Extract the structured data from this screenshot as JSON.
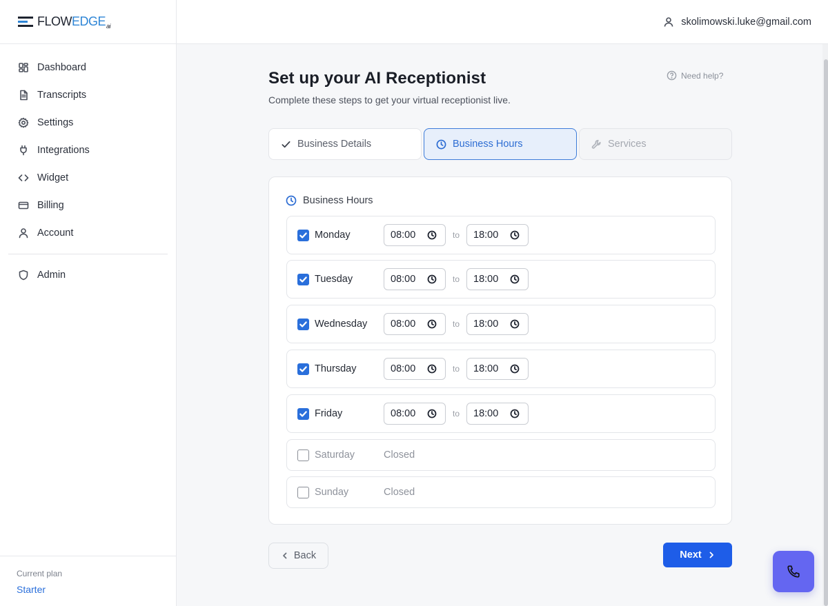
{
  "brand": {
    "part1": "FLOW",
    "part2": "EDGE",
    "part3": "ai"
  },
  "sidebar": {
    "items": [
      {
        "label": "Dashboard",
        "icon": "dashboard-icon"
      },
      {
        "label": "Transcripts",
        "icon": "document-icon"
      },
      {
        "label": "Settings",
        "icon": "gear-icon"
      },
      {
        "label": "Integrations",
        "icon": "plug-icon"
      },
      {
        "label": "Widget",
        "icon": "code-icon"
      },
      {
        "label": "Billing",
        "icon": "credit-card-icon"
      },
      {
        "label": "Account",
        "icon": "user-icon"
      }
    ],
    "admin": {
      "label": "Admin",
      "icon": "shield-icon"
    },
    "plan": {
      "label": "Current plan",
      "value": "Starter"
    }
  },
  "header": {
    "user_email": "skolimowski.luke@gmail.com"
  },
  "page": {
    "title": "Set up your AI Receptionist",
    "subtitle": "Complete these steps to get your virtual receptionist live.",
    "help_label": "Need help?"
  },
  "steps": [
    {
      "label": "Business Details",
      "state": "completed"
    },
    {
      "label": "Business Hours",
      "state": "active"
    },
    {
      "label": "Services",
      "state": "upcoming"
    }
  ],
  "hours": {
    "heading": "Business Hours",
    "to_label": "to",
    "closed_label": "Closed",
    "days": [
      {
        "name": "Monday",
        "enabled": true,
        "open": "08:00",
        "close": "18:00"
      },
      {
        "name": "Tuesday",
        "enabled": true,
        "open": "08:00",
        "close": "18:00"
      },
      {
        "name": "Wednesday",
        "enabled": true,
        "open": "08:00",
        "close": "18:00"
      },
      {
        "name": "Thursday",
        "enabled": true,
        "open": "08:00",
        "close": "18:00"
      },
      {
        "name": "Friday",
        "enabled": true,
        "open": "08:00",
        "close": "18:00"
      },
      {
        "name": "Saturday",
        "enabled": false
      },
      {
        "name": "Sunday",
        "enabled": false
      }
    ]
  },
  "actions": {
    "back_label": "Back",
    "next_label": "Next"
  },
  "colors": {
    "accent": "#2a6fdb",
    "primary_button": "#1e5de8",
    "fab": "#6466f1"
  }
}
